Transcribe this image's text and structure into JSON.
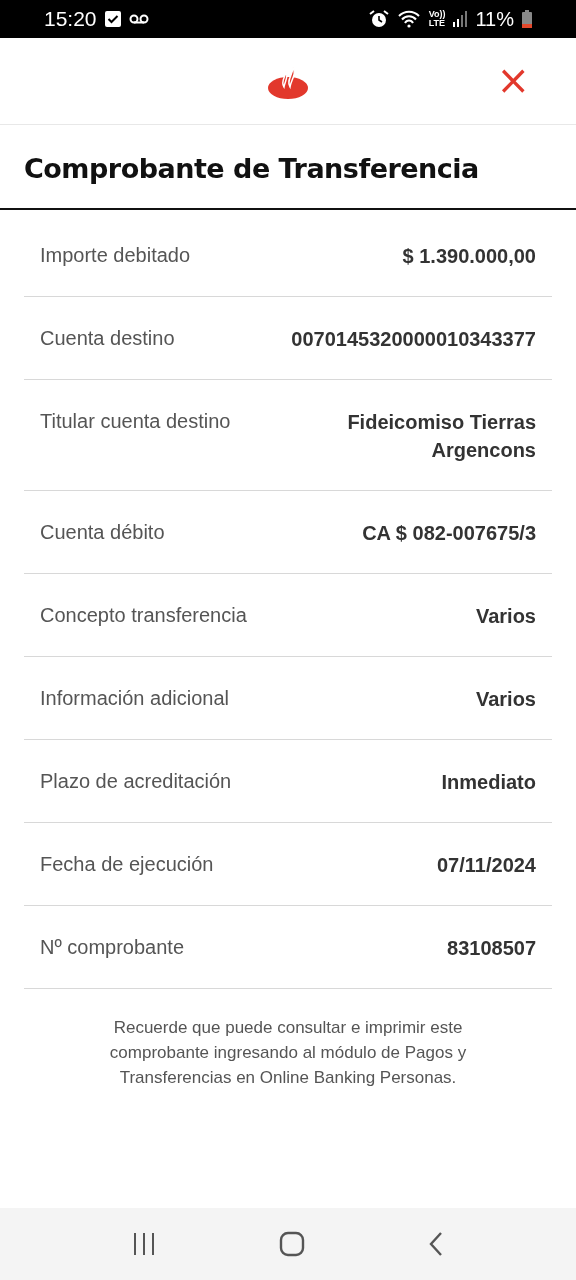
{
  "status_bar": {
    "time": "15:20",
    "volte_top": "Vo))",
    "volte_bottom": "LTE",
    "battery": "11%"
  },
  "header": {
    "close": "×"
  },
  "title": "Comprobante de Transferencia",
  "rows": [
    {
      "label": "Importe debitado",
      "value": "$ 1.390.000,00"
    },
    {
      "label": "Cuenta destino",
      "value": "0070145320000010343377"
    },
    {
      "label": "Titular cuenta destino",
      "value": "Fideicomiso Tierras Argencons"
    },
    {
      "label": "Cuenta débito",
      "value": "CA $ 082-007675/3"
    },
    {
      "label": "Concepto transferencia",
      "value": "Varios"
    },
    {
      "label": "Información adicional",
      "value": "Varios"
    },
    {
      "label": "Plazo de acreditación",
      "value": "Inmediato"
    },
    {
      "label": "Fecha de ejecución",
      "value": "07/11/2024"
    },
    {
      "label": "Nº comprobante",
      "value": "83108507"
    }
  ],
  "note": "Recuerde que puede consultar e imprimir este comprobante ingresando al módulo de Pagos y Transferencias en Online Banking Personas."
}
